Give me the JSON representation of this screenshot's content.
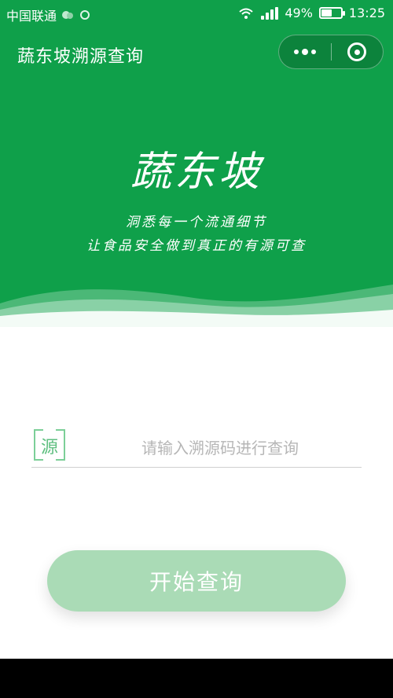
{
  "status_bar": {
    "carrier": "中国联通",
    "battery_percent": "49%",
    "battery_level": 0.49,
    "network": "3G",
    "time": "13:25"
  },
  "nav": {
    "title": "蔬东坡溯源查询"
  },
  "hero": {
    "brand": "蔬东坡",
    "slogan_line1": "洞悉每一个流通细节",
    "slogan_line2": "让食品安全做到真正的有源可查",
    "background_color": "#0fa04a"
  },
  "search": {
    "icon_char": "源",
    "placeholder": "请输入溯源码进行查询",
    "value": ""
  },
  "button": {
    "label": "开始查询",
    "color": "#aadbb6"
  }
}
